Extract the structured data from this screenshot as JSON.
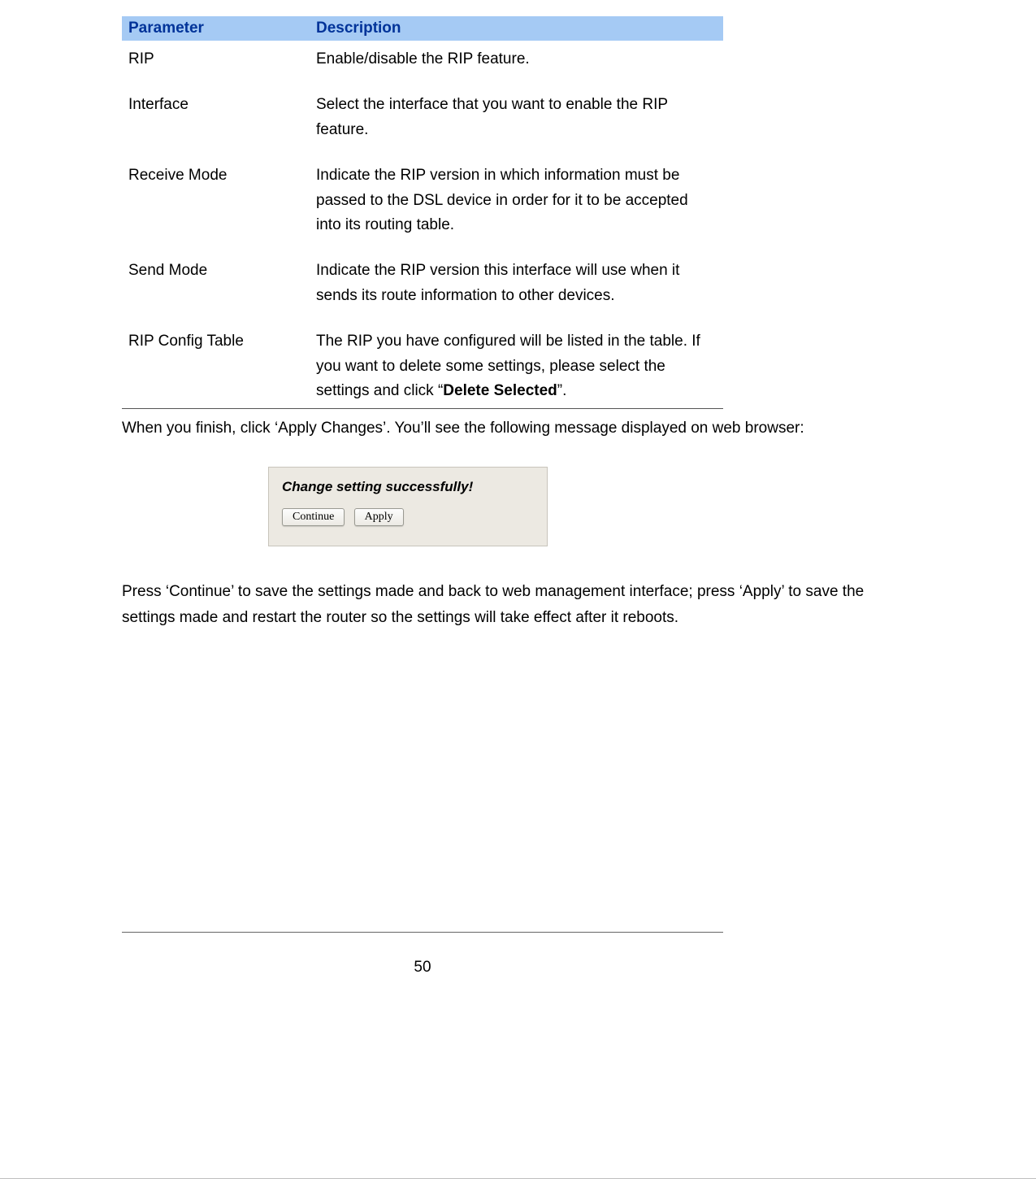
{
  "table": {
    "header": {
      "param": "Parameter",
      "desc": "Description"
    },
    "rows": [
      {
        "param": "RIP",
        "desc": "Enable/disable the RIP feature."
      },
      {
        "param": "Interface",
        "desc": "Select the interface that you want to enable the RIP feature."
      },
      {
        "param": "Receive Mode",
        "desc": "Indicate the RIP version in which information must be passed to the DSL device in order for it to be accepted into its routing table."
      },
      {
        "param": "Send Mode",
        "desc": "Indicate the RIP version this interface will use when it sends its route information to other devices."
      },
      {
        "param": "RIP Config Table",
        "desc_pre": "The RIP you have configured will be listed in the table. If you want to delete some settings, please select the settings and click “",
        "desc_bold": "Delete Selected",
        "desc_post": "”."
      }
    ]
  },
  "para1": "When you finish, click ‘Apply Changes’. You’ll see the following message displayed on web browser:",
  "dialog": {
    "title": "Change setting successfully!",
    "continue": "Continue",
    "apply": "Apply"
  },
  "para2": "Press ‘Continue’ to save the settings made and back to web management interface; press ‘Apply’ to save the settings made and restart the router so the settings will take effect after it reboots.",
  "page_number": "50"
}
